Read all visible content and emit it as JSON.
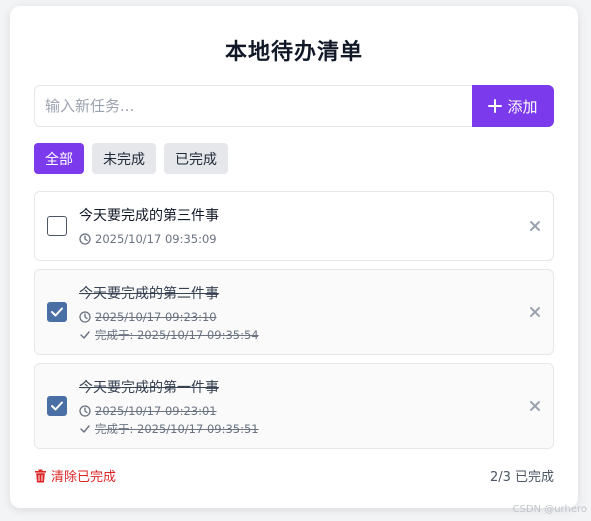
{
  "app": {
    "title": "本地待办清单"
  },
  "input": {
    "placeholder": "输入新任务...",
    "add_label": "添加"
  },
  "filters": {
    "all": "全部",
    "active": "未完成",
    "completed": "已完成",
    "selected": "全部"
  },
  "tasks": [
    {
      "text": "今天要完成的第三件事",
      "created": "2025/10/17 09:35:09",
      "done": false,
      "completed_label": ""
    },
    {
      "text": "今天要完成的第二件事",
      "created": "2025/10/17 09:23:10",
      "done": true,
      "completed_label": "完成于: 2025/10/17 09:35:54"
    },
    {
      "text": "今天要完成的第一件事",
      "created": "2025/10/17 09:23:01",
      "done": true,
      "completed_label": "完成于: 2025/10/17 09:35:51"
    }
  ],
  "footer": {
    "clear_label": "清除已完成",
    "count_label": "2/3 已完成"
  },
  "watermark": "CSDN @urhero",
  "colors": {
    "accent": "#7c3aed",
    "checkbox_checked": "#4a6fa5",
    "danger": "#dc2626"
  }
}
